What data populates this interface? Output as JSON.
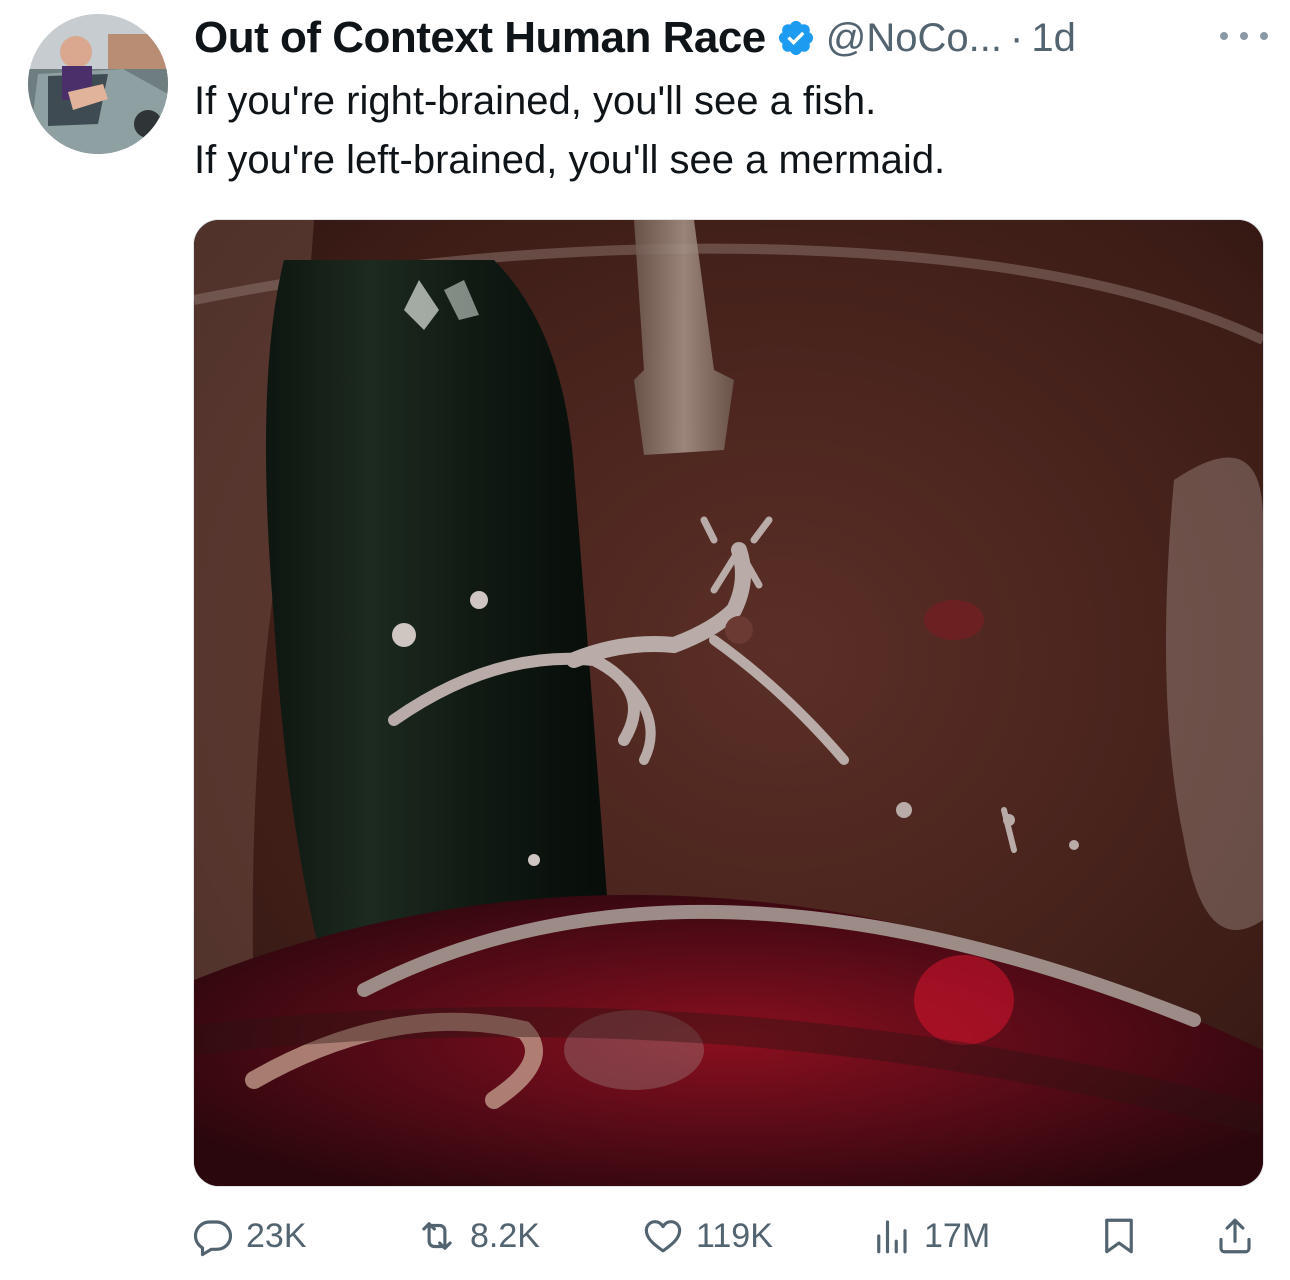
{
  "tweet": {
    "author_name": "Out of Context Human Race",
    "handle": "@NoCo...",
    "separator": "·",
    "time": "1d",
    "text_lines": [
      "If you're right-brained, you'll see a fish.",
      "If you're left-brained, you'll see a mermaid."
    ]
  },
  "icons": {
    "verified": "verified-badge-icon",
    "more": "more-options-icon",
    "reply": "reply-icon",
    "retweet": "retweet-icon",
    "like": "heart-icon",
    "views": "views-icon",
    "bookmark": "bookmark-icon",
    "share": "share-icon"
  },
  "actions": {
    "replies": "23K",
    "retweets": "8.2K",
    "likes": "119K",
    "views": "17M"
  },
  "colors": {
    "text": "#0f1419",
    "secondary": "#536471",
    "verified": "#1d9bf0"
  }
}
